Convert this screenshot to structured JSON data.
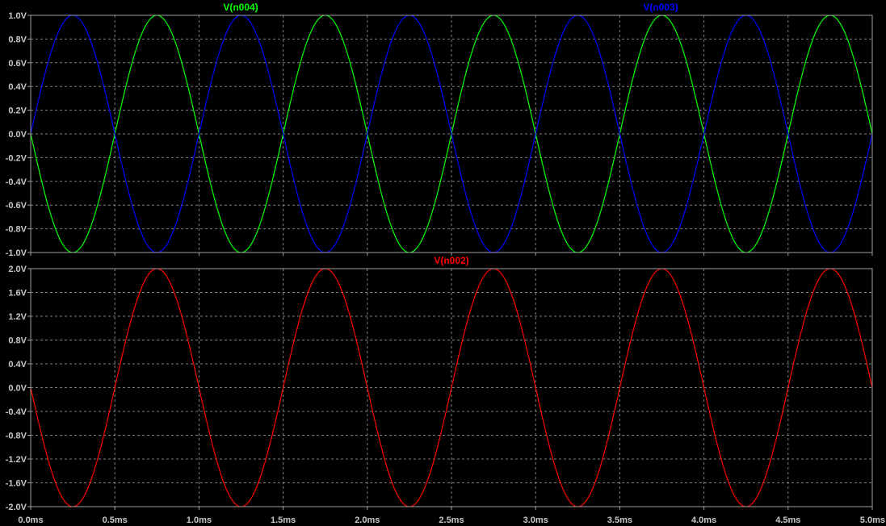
{
  "chart_data": [
    {
      "type": "line",
      "x_unit": "ms",
      "xlim": [
        0,
        5
      ],
      "ylim": [
        -1,
        1
      ],
      "grid": true,
      "series": [
        {
          "name": "V(n004)",
          "color": "#00ff00",
          "waveform": "sine",
          "frequency_khz": 1,
          "amplitude_v": 1,
          "phase_deg": 180
        },
        {
          "name": "V(n003)",
          "color": "#0000ff",
          "waveform": "sine",
          "frequency_khz": 1,
          "amplitude_v": 1,
          "phase_deg": 0
        }
      ],
      "x_ticks": [
        {
          "v": 0,
          "label": "0.0ms"
        },
        {
          "v": 0.5,
          "label": "0.5ms"
        },
        {
          "v": 1,
          "label": "1.0ms"
        },
        {
          "v": 1.5,
          "label": "1.5ms"
        },
        {
          "v": 2,
          "label": "2.0ms"
        },
        {
          "v": 2.5,
          "label": "2.5ms"
        },
        {
          "v": 3,
          "label": "3.0ms"
        },
        {
          "v": 3.5,
          "label": "3.5ms"
        },
        {
          "v": 4,
          "label": "4.0ms"
        },
        {
          "v": 4.5,
          "label": "4.5ms"
        },
        {
          "v": 5,
          "label": "5.0ms"
        }
      ],
      "y_ticks": [
        {
          "v": 1,
          "label": "1.0V"
        },
        {
          "v": 0.8,
          "label": "0.8V"
        },
        {
          "v": 0.6,
          "label": "0.6V"
        },
        {
          "v": 0.4,
          "label": "0.4V"
        },
        {
          "v": 0.2,
          "label": "0.2V"
        },
        {
          "v": 0,
          "label": "0.0V"
        },
        {
          "v": -0.2,
          "label": "-0.2V"
        },
        {
          "v": -0.4,
          "label": "-0.4V"
        },
        {
          "v": -0.6,
          "label": "-0.6V"
        },
        {
          "v": -0.8,
          "label": "-0.8V"
        },
        {
          "v": -1,
          "label": "-1.0V"
        }
      ]
    },
    {
      "type": "line",
      "x_unit": "ms",
      "xlim": [
        0,
        5
      ],
      "ylim": [
        -2,
        2
      ],
      "grid": true,
      "series": [
        {
          "name": "V(n002)",
          "color": "#ff0000",
          "waveform": "sine",
          "frequency_khz": 1,
          "amplitude_v": 2,
          "phase_deg": 180
        }
      ],
      "x_ticks": [
        {
          "v": 0,
          "label": "0.0ms"
        },
        {
          "v": 0.5,
          "label": "0.5ms"
        },
        {
          "v": 1,
          "label": "1.0ms"
        },
        {
          "v": 1.5,
          "label": "1.5ms"
        },
        {
          "v": 2,
          "label": "2.0ms"
        },
        {
          "v": 2.5,
          "label": "2.5ms"
        },
        {
          "v": 3,
          "label": "3.0ms"
        },
        {
          "v": 3.5,
          "label": "3.5ms"
        },
        {
          "v": 4,
          "label": "4.0ms"
        },
        {
          "v": 4.5,
          "label": "4.5ms"
        },
        {
          "v": 5,
          "label": "5.0ms"
        }
      ],
      "y_ticks": [
        {
          "v": 2,
          "label": "2.0V"
        },
        {
          "v": 1.6,
          "label": "1.6V"
        },
        {
          "v": 1.2,
          "label": "1.2V"
        },
        {
          "v": 0.8,
          "label": "0.8V"
        },
        {
          "v": 0.4,
          "label": "0.4V"
        },
        {
          "v": 0,
          "label": "0.0V"
        },
        {
          "v": -0.4,
          "label": "-0.4V"
        },
        {
          "v": -0.8,
          "label": "-0.8V"
        },
        {
          "v": -1.2,
          "label": "-1.2V"
        },
        {
          "v": -1.6,
          "label": "-1.6V"
        },
        {
          "v": -2,
          "label": "-2.0V"
        }
      ]
    }
  ]
}
